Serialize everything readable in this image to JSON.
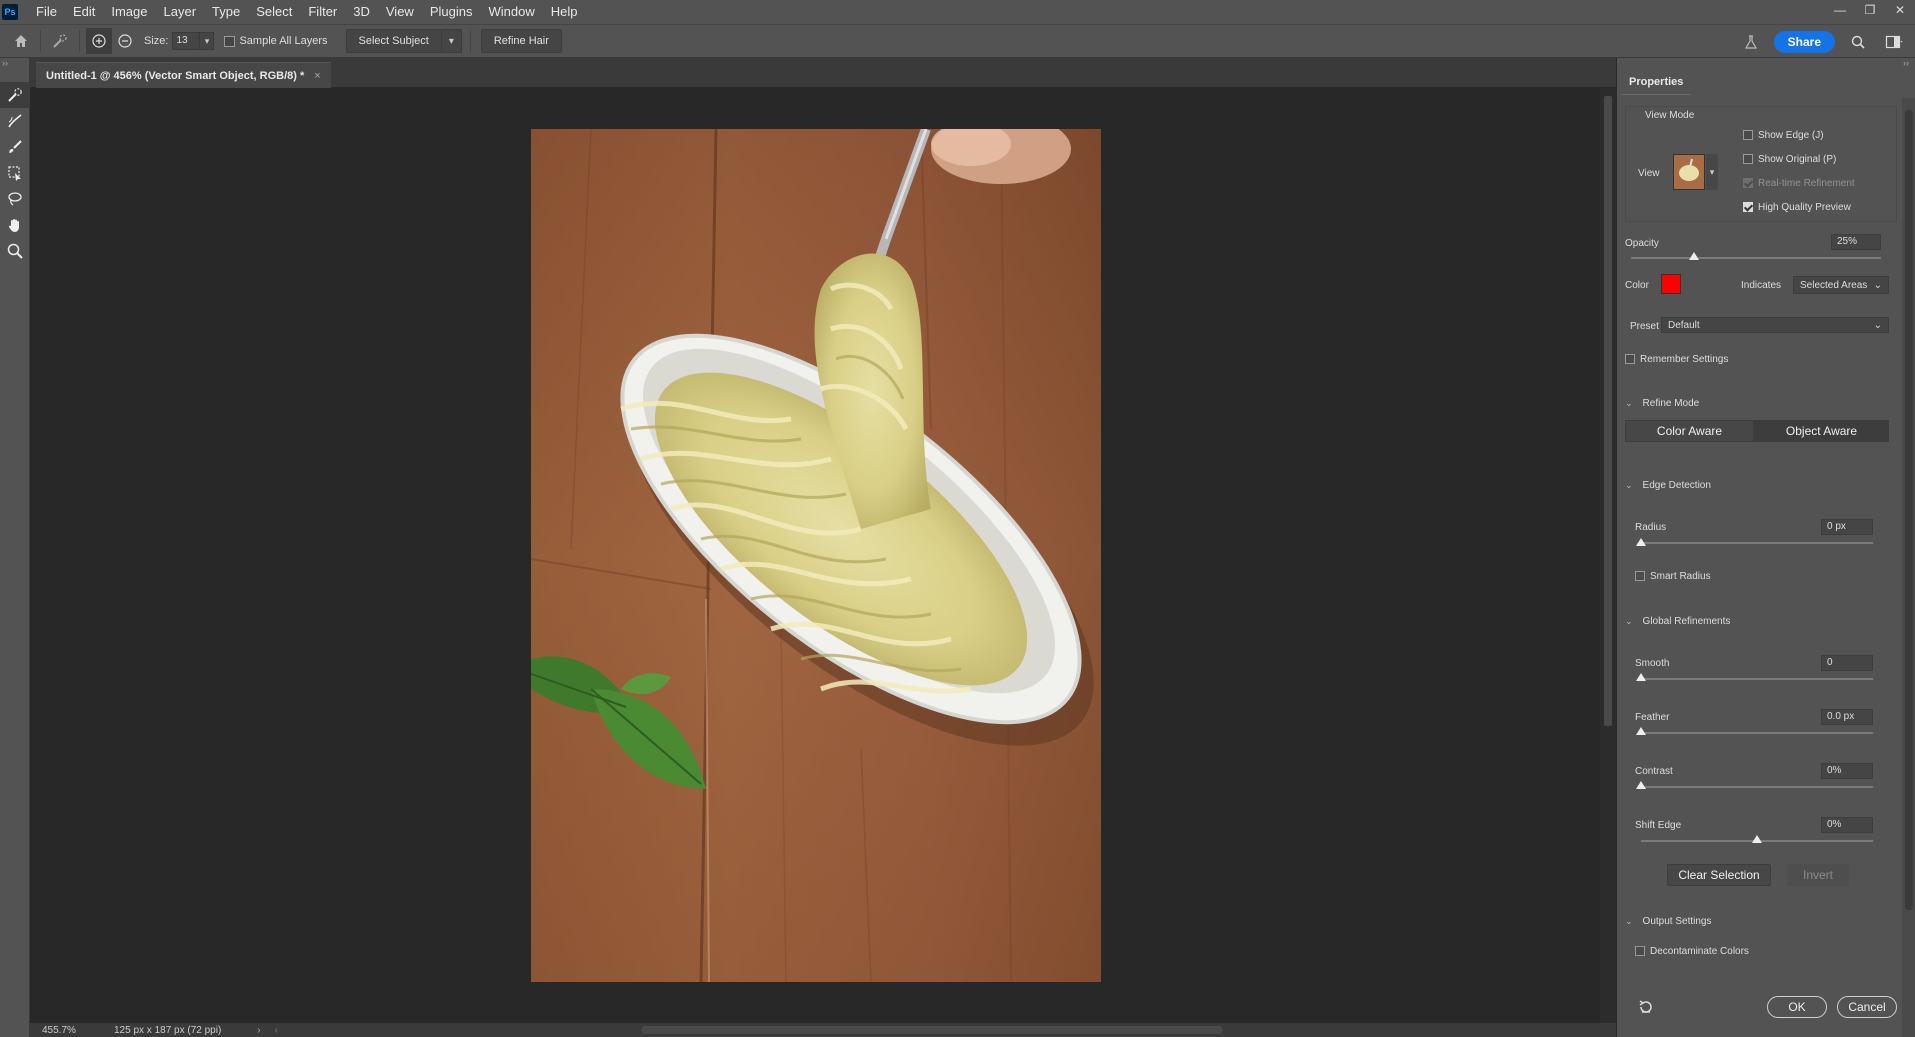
{
  "app": {
    "logo": "Ps"
  },
  "menu": [
    "File",
    "Edit",
    "Image",
    "Layer",
    "Type",
    "Select",
    "Filter",
    "3D",
    "View",
    "Plugins",
    "Window",
    "Help"
  ],
  "window_controls": {
    "minimize": "—",
    "restore": "❐",
    "close": "✕"
  },
  "options": {
    "size_label": "Size:",
    "size_value": "13",
    "sample_all_layers": "Sample All Layers",
    "select_subject": "Select Subject",
    "refine_hair": "Refine Hair",
    "share": "Share"
  },
  "document": {
    "tab_title": "Untitled-1 @ 456% (Vector Smart Object, RGB/8) *",
    "close": "×"
  },
  "status": {
    "zoom": "455.7%",
    "dimensions": "125 px x 187 px (72 ppi)"
  },
  "panel": {
    "tab": "Properties",
    "view_mode": {
      "title": "View Mode",
      "view_label": "View",
      "show_edge": "Show Edge (J)",
      "show_original": "Show Original (P)",
      "realtime": "Real-time Refinement",
      "high_quality": "High Quality Preview"
    },
    "opacity": {
      "label": "Opacity",
      "value": "25%",
      "level": 0.25
    },
    "color": {
      "label": "Color",
      "swatch": "#ff0000",
      "indicates_label": "Indicates",
      "indicates_value": "Selected Areas"
    },
    "preset": {
      "label": "Preset",
      "value": "Default"
    },
    "remember": "Remember Settings",
    "refine_mode": {
      "title": "Refine Mode",
      "color_aware": "Color Aware",
      "object_aware": "Object Aware"
    },
    "edge_detection": {
      "title": "Edge Detection",
      "radius_label": "Radius",
      "radius_value": "0 px",
      "smart_radius": "Smart Radius"
    },
    "global": {
      "title": "Global Refinements",
      "smooth_label": "Smooth",
      "smooth_value": "0",
      "feather_label": "Feather",
      "feather_value": "0.0 px",
      "contrast_label": "Contrast",
      "contrast_value": "0%",
      "shift_label": "Shift Edge",
      "shift_value": "0%"
    },
    "clear_selection": "Clear Selection",
    "invert": "Invert",
    "output": {
      "title": "Output Settings",
      "decontaminate": "Decontaminate Colors"
    },
    "ok": "OK",
    "cancel": "Cancel"
  },
  "colors": {
    "accent": "#1473e6",
    "chrome": "#535353",
    "canvas": "#282828"
  }
}
